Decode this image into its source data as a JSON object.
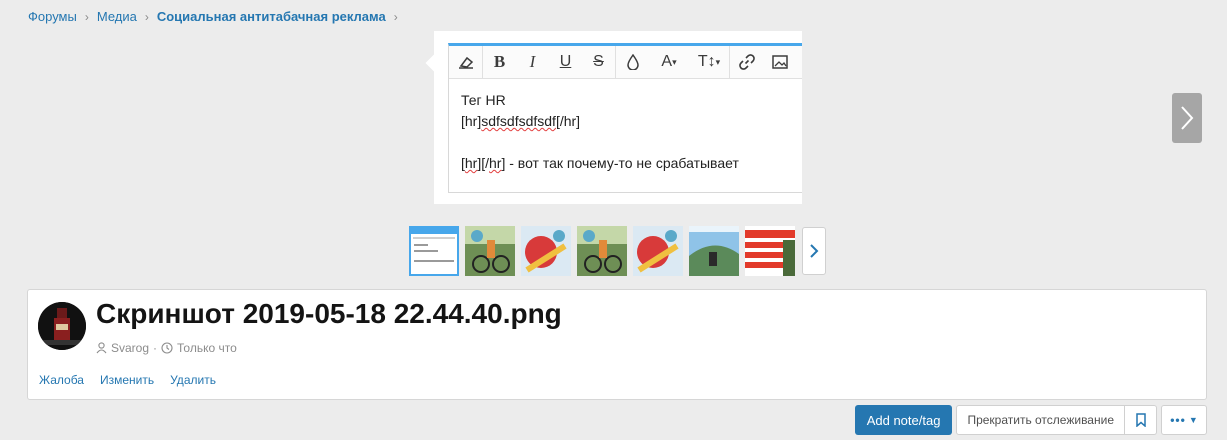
{
  "breadcrumb": {
    "items": [
      "Форумы",
      "Медиа",
      "Социальная антитабачная реклама"
    ]
  },
  "editor": {
    "line1": "Тег HR",
    "line2_open": "[hr]",
    "line2_text": "sdfsdfsdfsdf",
    "line2_close": "[/hr]",
    "line4_open_a": "[",
    "line4_hr1": "hr",
    "line4_mid": "][/",
    "line4_hr2": "hr",
    "line4_close": "]",
    "line4_rest": " - вот так почему-то не срабатывает"
  },
  "thumbnails": {
    "first_lines": [
      "Тег HR",
      "[hr]",
      "[hr][/hr] вот так почему-то не сраб"
    ]
  },
  "media": {
    "title": "Скриншот 2019-05-18 22.44.40.png",
    "author": "Svarog",
    "time": "Только что",
    "actions": [
      "Жалоба",
      "Изменить",
      "Удалить"
    ]
  },
  "buttons": {
    "add_note": "Add note/tag",
    "watch": "Прекратить отслеживание"
  },
  "colors": {
    "accent": "#2577b1",
    "editor_top": "#47a7eb",
    "background": "#ececec"
  }
}
